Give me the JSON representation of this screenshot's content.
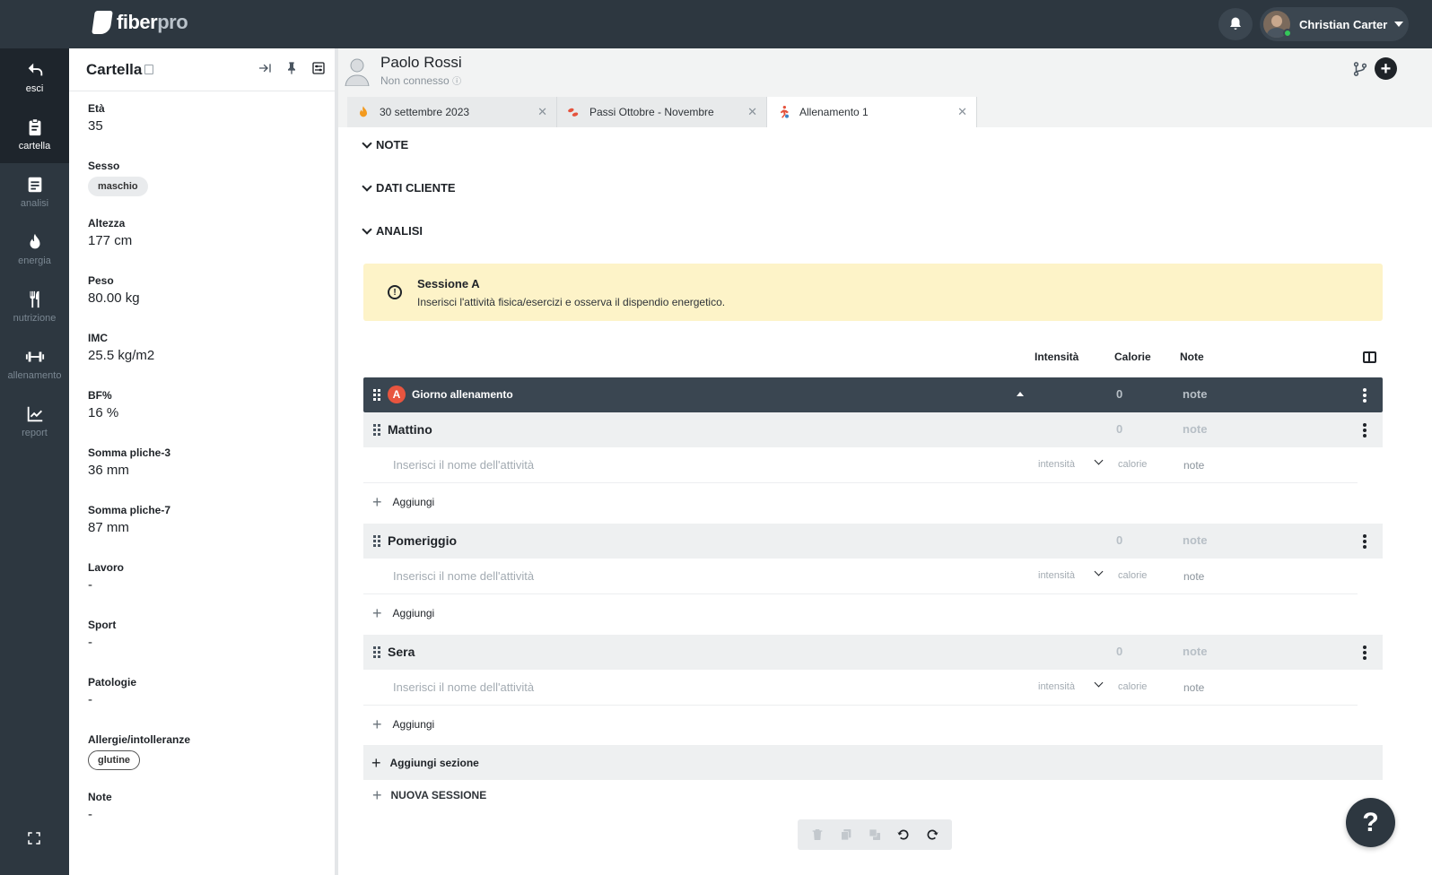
{
  "brand": {
    "name_part1": "fiber",
    "name_part2": "pro"
  },
  "user": {
    "name": "Christian Carter"
  },
  "nav": [
    {
      "label": "esci",
      "icon": "undo-arrow-icon"
    },
    {
      "label": "cartella",
      "icon": "clipboard-icon"
    },
    {
      "label": "analisi",
      "icon": "document-icon"
    },
    {
      "label": "energia",
      "icon": "flame-icon"
    },
    {
      "label": "nutrizione",
      "icon": "fork-knife-icon"
    },
    {
      "label": "allenamento",
      "icon": "dumbbell-icon"
    },
    {
      "label": "report",
      "icon": "chart-line-icon"
    }
  ],
  "panel": {
    "title": "Cartella",
    "fields": [
      {
        "label": "Età",
        "value": "35"
      },
      {
        "label": "Sesso",
        "chip": "maschio"
      },
      {
        "label": "Altezza",
        "value": "177 cm"
      },
      {
        "label": "Peso",
        "value": "80.00 kg"
      },
      {
        "label": "IMC",
        "value": "25.5 kg/m2"
      },
      {
        "label": "BF%",
        "value": "16 %"
      },
      {
        "label": "Somma pliche-3",
        "value": "36 mm"
      },
      {
        "label": "Somma pliche-7",
        "value": "87 mm"
      },
      {
        "label": "Lavoro",
        "value": "-"
      },
      {
        "label": "Sport",
        "value": "-"
      },
      {
        "label": "Patologie",
        "value": "-"
      },
      {
        "label": "Allergie/intolleranze",
        "chip": "glutine"
      },
      {
        "label": "Note",
        "value": "-"
      }
    ]
  },
  "patient": {
    "name": "Paolo Rossi",
    "status": "Non connesso"
  },
  "tabs": [
    {
      "label": "30 settembre 2023",
      "icon": "flame-icon"
    },
    {
      "label": "Passi Ottobre - Novembre",
      "icon": "footsteps-icon"
    },
    {
      "label": "Allenamento 1",
      "icon": "runner-icon"
    }
  ],
  "sections": {
    "note": "NOTE",
    "dati_cliente": "DATI CLIENTE",
    "analisi": "ANALISI"
  },
  "alert": {
    "title": "Sessione A",
    "description": "Inserisci l'attività fisica/esercizi e osserva il dispendio energetico."
  },
  "columns": {
    "intensita": "Intensità",
    "calorie": "Calorie",
    "note": "Note"
  },
  "day": {
    "badge": "A",
    "title": "Giorno allenamento",
    "calories": "0",
    "note": "note"
  },
  "blocks": [
    {
      "title": "Mattino",
      "calories": "0",
      "note": "note"
    },
    {
      "title": "Pomeriggio",
      "calories": "0",
      "note": "note"
    },
    {
      "title": "Sera",
      "calories": "0",
      "note": "note"
    }
  ],
  "activity": {
    "placeholder": "Inserisci il nome dell'attività",
    "intensity_placeholder": "intensità",
    "calories_placeholder": "calorie",
    "note_placeholder": "note"
  },
  "add_label": "Aggiungi",
  "add_section_label": "Aggiungi sezione",
  "new_session_label": "NUOVA SESSIONE",
  "help_label": "?"
}
